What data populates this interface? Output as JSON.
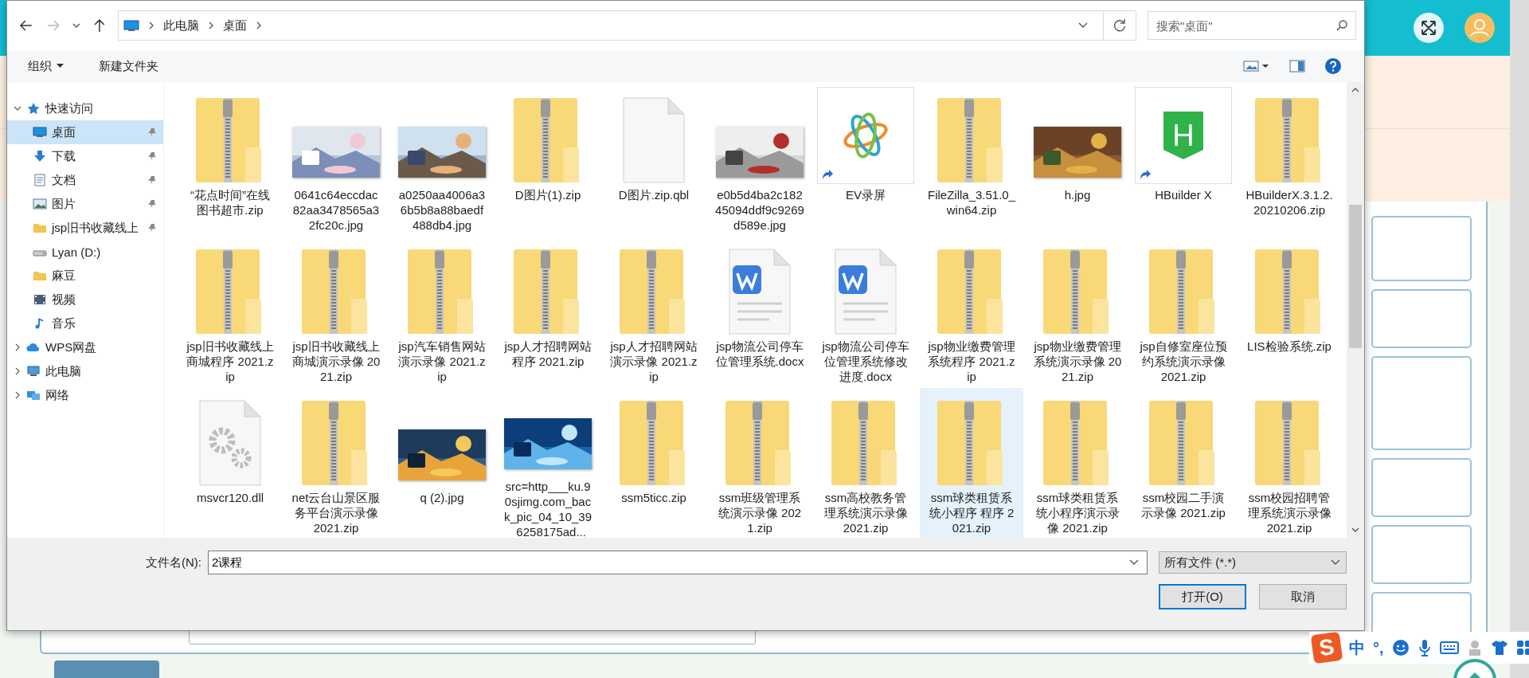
{
  "address": {
    "path": [
      "此电脑",
      "桌面"
    ],
    "search_placeholder": "搜索\"桌面\""
  },
  "toolbar": {
    "organize": "组织",
    "new_folder": "新建文件夹"
  },
  "nav": [
    {
      "label": "快速访问",
      "kind": "star",
      "expanded": true,
      "children": [
        {
          "label": "桌面",
          "kind": "desktop",
          "pinned": true,
          "selected": true
        },
        {
          "label": "下载",
          "kind": "download",
          "pinned": true,
          "selected": false
        },
        {
          "label": "文档",
          "kind": "document",
          "pinned": true,
          "selected": false
        },
        {
          "label": "图片",
          "kind": "pictures",
          "pinned": true,
          "selected": false
        },
        {
          "label": "jsp旧书收藏线上",
          "kind": "folder",
          "pinned": true,
          "selected": false
        },
        {
          "label": "Lyan (D:)",
          "kind": "drive",
          "pinned": false,
          "selected": false
        },
        {
          "label": "麻豆",
          "kind": "folder",
          "pinned": false,
          "selected": false
        },
        {
          "label": "视频",
          "kind": "video",
          "pinned": false,
          "selected": false
        },
        {
          "label": "音乐",
          "kind": "music",
          "pinned": false,
          "selected": false
        }
      ]
    },
    {
      "label": "WPS网盘",
      "kind": "cloud",
      "expanded": false
    },
    {
      "label": "此电脑",
      "kind": "pc",
      "expanded": false
    },
    {
      "label": "网络",
      "kind": "network",
      "expanded": false
    }
  ],
  "files": [
    {
      "name": "“花点时间”在线图书超市.zip",
      "kind": "zip",
      "selected": false
    },
    {
      "name": "0641c64eccdac82aa3478565a32fc20c.jpg",
      "selected": false
    },
    {
      "name": "a0250aa4006a36b5b8a88baedf488db4.jpg",
      "selected": false
    },
    {
      "name": "D图片(1).zip",
      "kind": "zip",
      "selected": false
    },
    {
      "name": "D图片.zip.qbl",
      "kind": "blank",
      "selected": false
    },
    {
      "name": "e0b5d4ba2c18245094ddf9c9269d589e.jpg",
      "selected": false
    },
    {
      "name": "EV录屏",
      "kind": "app",
      "selected": false
    },
    {
      "name": "FileZilla_3.51.0_win64.zip",
      "kind": "zip",
      "selected": false
    },
    {
      "name": "h.jpg",
      "selected": false
    },
    {
      "name": "HBuilder X",
      "kind": "app",
      "badge": "H",
      "selected": false
    },
    {
      "name": "HBuilderX.3.1.2.20210206.zip",
      "kind": "zip",
      "selected": false
    },
    {
      "name": "jsp旧书收藏线上商城程序 2021.zip",
      "kind": "zip",
      "selected": false
    },
    {
      "name": "jsp旧书收藏线上商城演示录像 2021.zip",
      "kind": "zip",
      "selected": false
    },
    {
      "name": "jsp汽车销售网站演示录像 2021.zip",
      "kind": "zip",
      "selected": false
    },
    {
      "name": "jsp人才招聘网站程序 2021.zip",
      "kind": "zip",
      "selected": false
    },
    {
      "name": "jsp人才招聘网站演示录像 2021.zip",
      "kind": "zip",
      "selected": false
    },
    {
      "name": "jsp物流公司停车位管理系统.docx",
      "kind": "docx",
      "selected": false
    },
    {
      "name": "jsp物流公司停车位管理系统修改进度.docx",
      "kind": "docx",
      "selected": false
    },
    {
      "name": "jsp物业缴费管理系统程序 2021.zip",
      "kind": "zip",
      "selected": false
    },
    {
      "name": "jsp物业缴费管理系统演示录像 2021.zip",
      "kind": "zip",
      "selected": false
    },
    {
      "name": "jsp自修室座位预约系统演示录像 2021.zip",
      "kind": "zip",
      "selected": false
    },
    {
      "name": "LIS检验系统.zip",
      "kind": "zip",
      "selected": false
    },
    {
      "name": "msvcr120.dll",
      "kind": "dll",
      "selected": false
    },
    {
      "name": "net云台山景区服务平台演示录像 2021.zip",
      "kind": "zip",
      "selected": false
    },
    {
      "name": "q (2).jpg",
      "selected": false
    },
    {
      "name": "src=http___ku.90sjimg.com_back_pic_04_10_39_6258175ad...",
      "selected": false
    },
    {
      "name": "ssm5ticc.zip",
      "kind": "zip",
      "selected": false
    },
    {
      "name": "ssm班级管理系统演示录像 2021.zip",
      "kind": "zip",
      "selected": false
    },
    {
      "name": "ssm高校教务管理系统演示录像 2021.zip",
      "kind": "zip",
      "selected": false
    },
    {
      "name": "ssm球类租赁系统小程序 程序 2021.zip",
      "kind": "zip",
      "selected": true
    },
    {
      "name": "ssm球类租赁系统小程序演示录像 2021.zip",
      "kind": "zip",
      "selected": false
    },
    {
      "name": "ssm校园二手演示录像 2021.zip",
      "kind": "zip",
      "selected": false
    },
    {
      "name": "ssm校园招聘管理系统演示录像 2021.zip",
      "kind": "zip",
      "selected": false
    }
  ],
  "footer": {
    "filename_label": "文件名(N):",
    "filename": "2课程",
    "filter": "所有文件 (*.*)",
    "buttons": [
      {
        "label": "打开(O)",
        "default": true
      },
      {
        "label": "取消",
        "default": false
      }
    ]
  },
  "ime_bar": {
    "logo": "S",
    "mode": "中",
    "punctuation": "°,"
  }
}
